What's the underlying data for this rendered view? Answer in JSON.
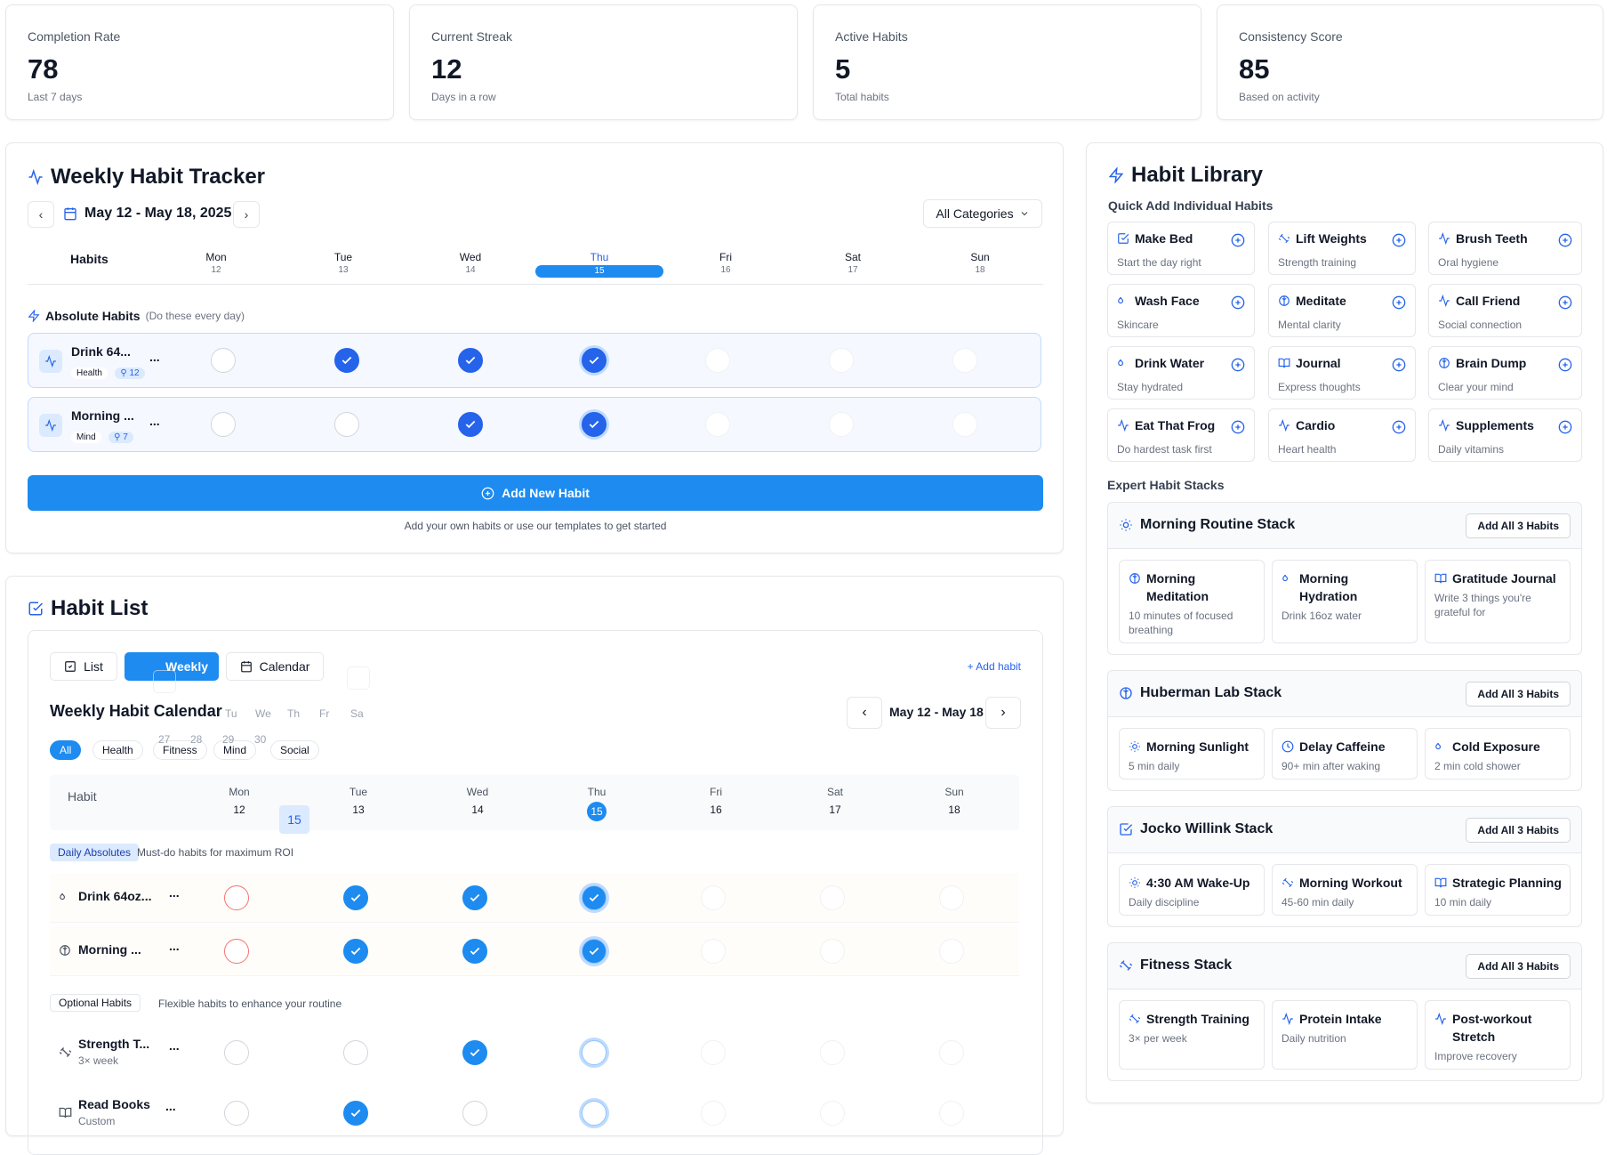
{
  "stats": [
    {
      "label": "Completion Rate",
      "value": "78",
      "sub": "Last 7 days"
    },
    {
      "label": "Current Streak",
      "value": "12",
      "sub": "Days in a row"
    },
    {
      "label": "Active Habits",
      "value": "5",
      "sub": "Total habits"
    },
    {
      "label": "Consistency Score",
      "value": "85",
      "sub": "Based on activity"
    }
  ],
  "tracker": {
    "title": "Weekly Habit Tracker",
    "date_range": "May 12 - May 18, 2025",
    "category": "All Categories",
    "habits_header": "Habits",
    "days": [
      {
        "d": "Mon",
        "n": "12"
      },
      {
        "d": "Tue",
        "n": "13"
      },
      {
        "d": "Wed",
        "n": "14"
      },
      {
        "d": "Thu",
        "n": "15"
      },
      {
        "d": "Fri",
        "n": "16"
      },
      {
        "d": "Sat",
        "n": "17"
      },
      {
        "d": "Sun",
        "n": "18"
      }
    ],
    "section_title": "Absolute Habits",
    "section_note": "(Do these every day)",
    "habits": [
      {
        "name": "Drink 64...",
        "tag": "Health",
        "count": "12",
        "more": "..."
      },
      {
        "name": "Morning ...",
        "tag": "Mind",
        "count": "7",
        "more": "..."
      }
    ],
    "add_button": "Add New Habit",
    "add_hint": "Add your own habits or use our templates to get started"
  },
  "habit_list": {
    "title": "Habit List",
    "view_tabs": [
      "List",
      "Weekly",
      "Calendar"
    ],
    "add_habit": "+ Add habit",
    "calendar_title": "Weekly Habit Calendar",
    "range": "May 12 - May 18",
    "filters": [
      "All",
      "Health",
      "Fitness",
      "Mind",
      "Social"
    ],
    "ghost_days": [
      "Tu",
      "We",
      "Th",
      "Fr",
      "Sa"
    ],
    "ghost_nums": [
      "27",
      "28",
      "29",
      "30"
    ],
    "ghost_today": "15",
    "habit_header": "Habit",
    "days": [
      {
        "d": "Mon",
        "n": "12"
      },
      {
        "d": "Tue",
        "n": "13"
      },
      {
        "d": "Wed",
        "n": "14"
      },
      {
        "d": "Thu",
        "n": "15"
      },
      {
        "d": "Fri",
        "n": "16"
      },
      {
        "d": "Sat",
        "n": "17"
      },
      {
        "d": "Sun",
        "n": "18"
      }
    ],
    "daily_label": "Daily Absolutes",
    "daily_note": "Must-do habits for maximum ROI",
    "optional_label": "Optional Habits",
    "optional_note": "Flexible habits to enhance your routine",
    "rows": [
      {
        "name": "Drink 64oz...",
        "sub": ""
      },
      {
        "name": "Morning ...",
        "sub": ""
      },
      {
        "name": "Strength T...",
        "sub": "3× week"
      },
      {
        "name": "Read Books",
        "sub": "Custom"
      }
    ],
    "more": "..."
  },
  "library": {
    "title": "Habit Library",
    "quick_title": "Quick Add Individual Habits",
    "items": [
      {
        "name": "Make Bed",
        "desc": "Start the day right",
        "icon": "check-square-icon"
      },
      {
        "name": "Lift Weights",
        "desc": "Strength training",
        "icon": "dumbbell-icon"
      },
      {
        "name": "Brush Teeth",
        "desc": "Oral hygiene",
        "icon": "activity-icon"
      },
      {
        "name": "Wash Face",
        "desc": "Skincare",
        "icon": "droplets-icon"
      },
      {
        "name": "Meditate",
        "desc": "Mental clarity",
        "icon": "brain-icon"
      },
      {
        "name": "Call Friend",
        "desc": "Social connection",
        "icon": "activity-icon"
      },
      {
        "name": "Drink Water",
        "desc": "Stay hydrated",
        "icon": "droplets-icon"
      },
      {
        "name": "Journal",
        "desc": "Express thoughts",
        "icon": "book-icon"
      },
      {
        "name": "Brain Dump",
        "desc": "Clear your mind",
        "icon": "brain-icon"
      },
      {
        "name": "Eat That Frog",
        "desc": "Do hardest task first",
        "icon": "activity-icon"
      },
      {
        "name": "Cardio",
        "desc": "Heart health",
        "icon": "activity-icon"
      },
      {
        "name": "Supplements",
        "desc": "Daily vitamins",
        "icon": "activity-icon"
      }
    ],
    "expert_title": "Expert Habit Stacks",
    "add_all": "Add All 3 Habits",
    "stacks": [
      {
        "name": "Morning Routine Stack",
        "items": [
          {
            "name": "Morning Meditation",
            "desc": "10 minutes of focused breathing"
          },
          {
            "name": "Morning Hydration",
            "desc": "Drink 16oz water"
          },
          {
            "name": "Gratitude Journal",
            "desc": "Write 3 things you're grateful for"
          }
        ]
      },
      {
        "name": "Huberman Lab Stack",
        "items": [
          {
            "name": "Morning Sunlight",
            "desc": "5 min daily"
          },
          {
            "name": "Delay Caffeine",
            "desc": "90+ min after waking"
          },
          {
            "name": "Cold Exposure",
            "desc": "2 min cold shower"
          }
        ]
      },
      {
        "name": "Jocko Willink Stack",
        "items": [
          {
            "name": "4:30 AM Wake-Up",
            "desc": "Daily discipline"
          },
          {
            "name": "Morning Workout",
            "desc": "45-60 min daily"
          },
          {
            "name": "Strategic Planning",
            "desc": "10 min daily"
          }
        ]
      },
      {
        "name": "Fitness Stack",
        "items": [
          {
            "name": "Strength Training",
            "desc": "3× per week"
          },
          {
            "name": "Protein Intake",
            "desc": "Daily nutrition"
          },
          {
            "name": "Post-workout Stretch",
            "desc": "Improve recovery"
          }
        ]
      }
    ]
  },
  "colors": {
    "accent": "#2563eb",
    "button": "#1d8bf0",
    "row_bg": "#f5f8ff"
  }
}
